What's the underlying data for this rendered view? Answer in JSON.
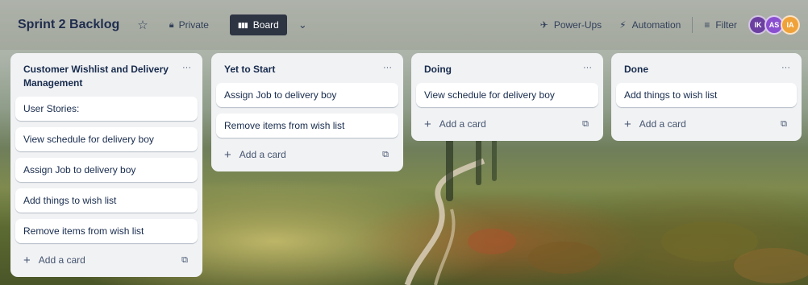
{
  "header": {
    "title": "Sprint 2 Backlog",
    "star_icon": "star-icon",
    "visibility_label": "Private",
    "view_label": "Board",
    "powerups_label": "Power-Ups",
    "automation_label": "Automation",
    "filter_label": "Filter",
    "avatars": [
      {
        "initials": "IK",
        "color": "#6b3fa0"
      },
      {
        "initials": "AS",
        "color": "#8a4fd0"
      },
      {
        "initials": "IA",
        "color": "#f0a23a"
      }
    ]
  },
  "lists": [
    {
      "title": "Customer Wishlist and Delivery Management",
      "menu": "···",
      "cards": [
        "User Stories:",
        "View schedule for delivery boy",
        "Assign Job to delivery boy",
        "Add things to wish list",
        "Remove items from wish list"
      ],
      "add_label": "Add a card"
    },
    {
      "title": "Yet to Start",
      "menu": "···",
      "cards": [
        "Assign Job to delivery boy",
        "Remove items from wish list"
      ],
      "add_label": "Add a card"
    },
    {
      "title": "Doing",
      "menu": "···",
      "cards": [
        "View schedule for delivery boy"
      ],
      "add_label": "Add a card"
    },
    {
      "title": "Done",
      "menu": "···",
      "cards": [
        "Add things to wish list"
      ],
      "add_label": "Add a card"
    }
  ]
}
